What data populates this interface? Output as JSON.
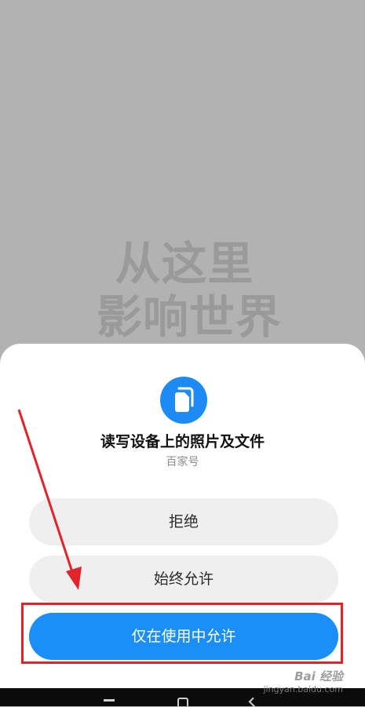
{
  "background": {
    "slogan_line1": "从这里",
    "slogan_line2": "影响世界"
  },
  "permission_dialog": {
    "icon": "file-copy-icon",
    "title": "读写设备上的照片及文件",
    "app_name": "百家号",
    "buttons": {
      "deny": "拒绝",
      "always_allow": "始终允许",
      "allow_while_using": "仅在使用中允许"
    }
  },
  "watermark": {
    "logo": "Bai 经验",
    "url": "jingyan.baidu.com"
  },
  "colors": {
    "accent": "#1b8ef8",
    "highlight": "#e3232a",
    "overlay": "#b2b2b2"
  }
}
